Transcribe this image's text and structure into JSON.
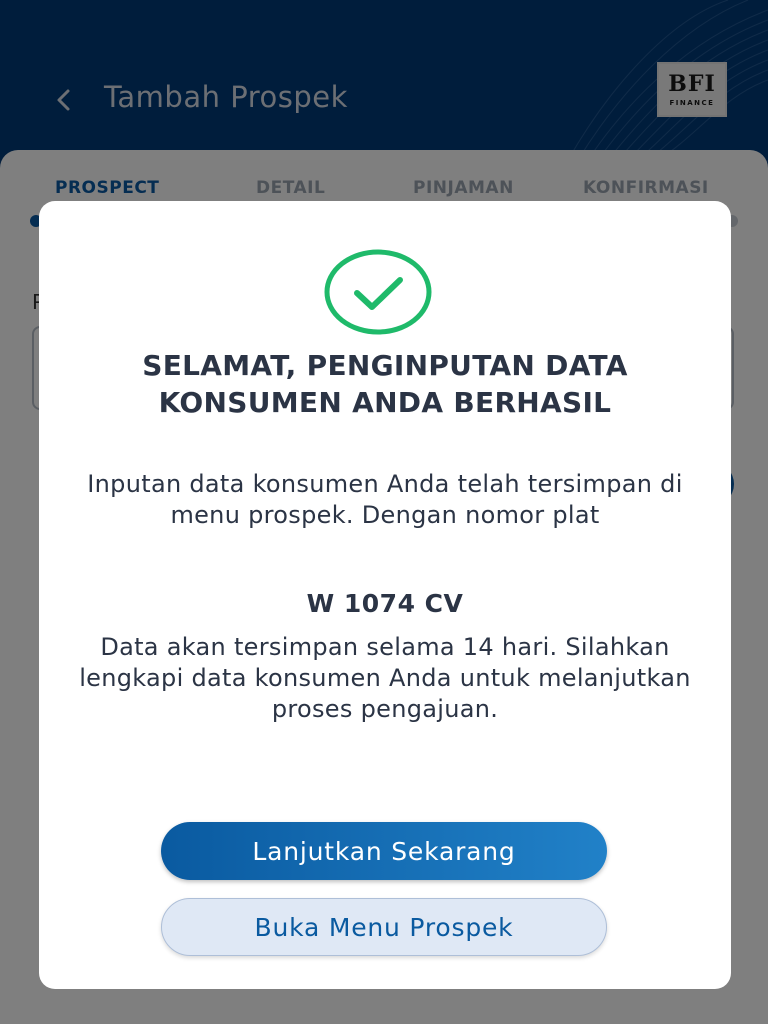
{
  "header": {
    "title": "Tambah Prospek",
    "back_icon": "chevron-left-icon",
    "logo": {
      "main": "BFI",
      "sub": "FINANCE"
    }
  },
  "steps": [
    {
      "label": "PROSPECT",
      "active": true
    },
    {
      "label": "DETAIL",
      "active": false
    },
    {
      "label": "PINJAMAN",
      "active": false
    },
    {
      "label": "KONFIRMASI",
      "active": false
    }
  ],
  "background_form": {
    "field_label": "P"
  },
  "modal": {
    "icon": "check-circle-icon",
    "title": "SELAMAT, PENGINPUTAN DATA KONSUMEN ANDA BERHASIL",
    "body": "Inputan data konsumen Anda telah tersimpan di menu prospek. Dengan nomor plat",
    "plate_number": "W 1074 CV",
    "note": "Data akan tersimpan selama 14 hari. Silahkan lengkapi data konsumen Anda untuk melanjutkan proses pengajuan.",
    "primary_button": "Lanjutkan Sekarang",
    "secondary_button": "Buka Menu Prospek"
  },
  "colors": {
    "header_bg": "#003a78",
    "primary": "#0a5aa0",
    "success": "#1fba6a",
    "overlay": "rgba(0,0,0,0.5)"
  }
}
